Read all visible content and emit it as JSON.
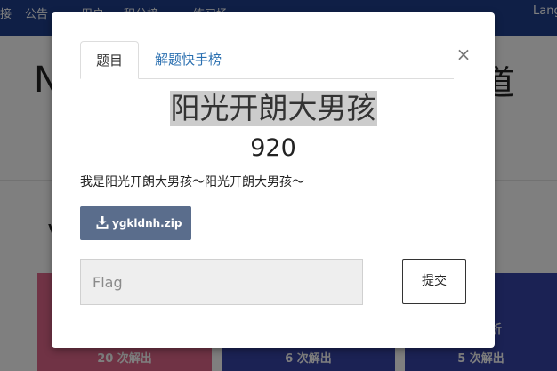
{
  "navbar": {
    "items": [
      "接",
      "公告",
      "用户",
      "积分榜",
      "练习场"
    ],
    "language": "Lang"
  },
  "background": {
    "title_left": "N",
    "title_right": "道",
    "section_letter": "V",
    "cards": [
      {
        "extra": "",
        "solved": "20 次解出"
      },
      {
        "extra": "",
        "solved": "6 次解出"
      },
      {
        "extra": "析",
        "solved": "5 次解出"
      }
    ]
  },
  "modal": {
    "tabs": [
      "题目",
      "解题快手榜"
    ],
    "close_label": "×",
    "challenge": {
      "name": "阳光开朗大男孩",
      "value": "920",
      "description": "我是阳光开朗大男孩～阳光开朗大男孩～",
      "file": "ygkldnh.zip"
    },
    "flag_placeholder": "Flag",
    "submit_label": "提交"
  },
  "colors": {
    "navbar": "#1f3f8c",
    "card_pink": "#e1668a",
    "card_blue": "#3644a8",
    "download_button": "#5a6d8c"
  }
}
